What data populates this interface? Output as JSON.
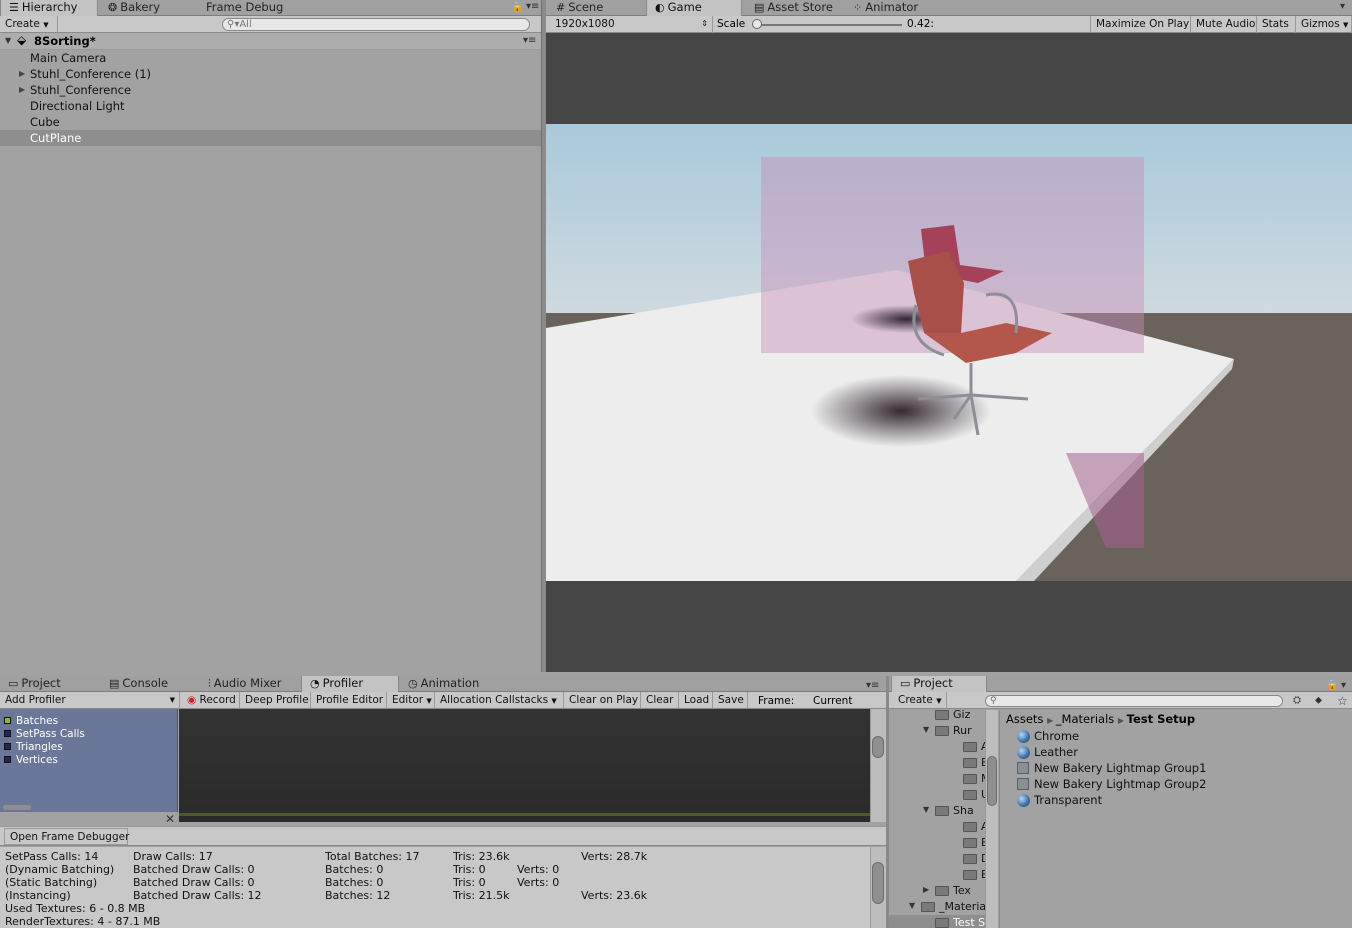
{
  "hierarchy": {
    "tabs": [
      "Hierarchy",
      "Bakery",
      "Frame Debug"
    ],
    "create_label": "Create",
    "search_placeholder": "All",
    "scene_name": "8Sorting*",
    "items": [
      "Main Camera",
      "Stuhl_Conference (1)",
      "Stuhl_Conference",
      "Directional Light",
      "Cube",
      "CutPlane"
    ],
    "selected_index": 5
  },
  "game": {
    "tabs": [
      "Scene",
      "Game",
      "Asset Store",
      "Animator"
    ],
    "resolution": "1920x1080",
    "scale_label": "Scale",
    "scale_value": "0.42:",
    "scale_fraction": 0.0,
    "buttons": [
      "Maximize On Play",
      "Mute Audio",
      "Stats",
      "Gizmos"
    ]
  },
  "profiler": {
    "tabs": [
      "Project",
      "Console",
      "Audio Mixer",
      "Profiler",
      "Animation"
    ],
    "add_profiler": "Add Profiler",
    "toolbar": [
      "Record",
      "Deep Profile",
      "Profile Editor",
      "Editor",
      "Allocation Callstacks",
      "Clear on Play",
      "Clear",
      "Load",
      "Save"
    ],
    "frame_label": "Frame:",
    "frame_value": "Current",
    "legend": [
      "Batches",
      "SetPass Calls",
      "Triangles",
      "Vertices"
    ],
    "legend_colors": [
      "#8fb53a",
      "#1e2a54",
      "#1e2a54",
      "#1e2a54"
    ],
    "open_frame_debugger": "Open Frame Debugger",
    "stats": {
      "col1": [
        "SetPass Calls: 14",
        "(Dynamic Batching)",
        "(Static Batching)",
        "(Instancing)",
        "Used Textures: 6 - 0.8 MB",
        "RenderTextures: 4 - 87.1 MB"
      ],
      "col2": [
        "Draw Calls: 17",
        "Batched Draw Calls: 0",
        "Batched Draw Calls: 0",
        "Batched Draw Calls: 12"
      ],
      "col3": [
        "Total Batches: 17",
        "Batches: 0",
        "Batches: 0",
        "Batches: 12"
      ],
      "col4": [
        "Tris: 23.6k",
        "Tris: 0",
        "Tris: 0",
        "Tris: 21.5k"
      ],
      "col5": [
        "",
        "Verts: 0",
        "Verts: 0",
        ""
      ],
      "col6": [
        "Verts: 28.7k",
        "",
        "",
        "Verts: 23.6k"
      ]
    }
  },
  "project": {
    "tab": "Project",
    "create_label": "Create",
    "breadcrumb": [
      "Assets",
      "_Materials",
      "Test Setup"
    ],
    "tree": [
      {
        "label": "Giz",
        "indent": 1
      },
      {
        "label": "Rur",
        "indent": 1
      },
      {
        "label": "A",
        "indent": 2
      },
      {
        "label": "B",
        "indent": 2
      },
      {
        "label": "M",
        "indent": 2
      },
      {
        "label": "U",
        "indent": 2
      },
      {
        "label": "Sha",
        "indent": 1
      },
      {
        "label": "A",
        "indent": 2
      },
      {
        "label": "B",
        "indent": 2
      },
      {
        "label": "D",
        "indent": 2
      },
      {
        "label": "E",
        "indent": 2
      },
      {
        "label": "Tex",
        "indent": 1
      },
      {
        "label": "_Materia",
        "indent": 0
      },
      {
        "label": "Test S",
        "indent": 1
      }
    ],
    "assets": [
      {
        "name": "Chrome",
        "kind": "material"
      },
      {
        "name": "Leather",
        "kind": "material"
      },
      {
        "name": "New Bakery Lightmap Group1",
        "kind": "asset"
      },
      {
        "name": "New Bakery Lightmap Group2",
        "kind": "asset"
      },
      {
        "name": "Transparent",
        "kind": "material"
      }
    ]
  }
}
